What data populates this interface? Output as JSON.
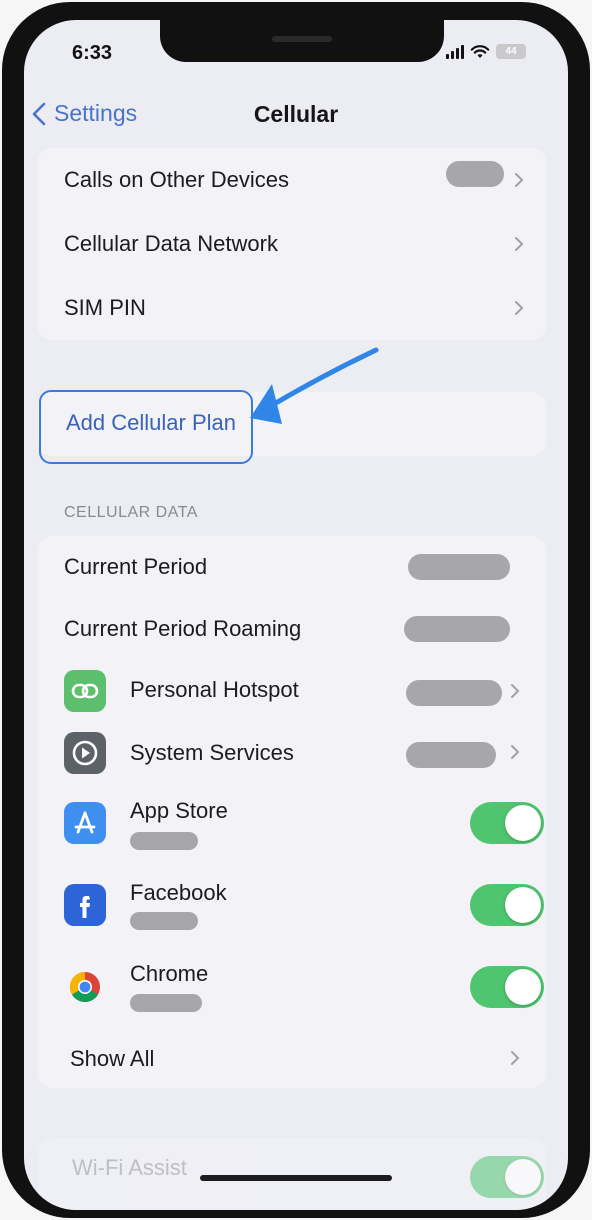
{
  "status_bar": {
    "time": "6:33",
    "battery": "44"
  },
  "nav": {
    "back_label": "Settings",
    "title": "Cellular"
  },
  "top_group": {
    "calls_on_other_devices": "Calls on Other Devices",
    "cellular_data_network": "Cellular Data Network",
    "sim_pin": "SIM PIN"
  },
  "add_plan": {
    "label": "Add Cellular Plan"
  },
  "cellular_data": {
    "header": "CELLULAR DATA",
    "current_period": "Current Period",
    "current_period_roaming": "Current Period Roaming",
    "personal_hotspot": "Personal Hotspot",
    "system_services": "System Services",
    "apps": [
      {
        "name": "App Store",
        "icon": "app-store-icon",
        "enabled": true
      },
      {
        "name": "Facebook",
        "icon": "facebook-icon",
        "enabled": true
      },
      {
        "name": "Chrome",
        "icon": "chrome-icon",
        "enabled": true
      }
    ],
    "show_all": "Show All"
  },
  "bottom_group": {
    "wifi_assist": "Wi-Fi Assist"
  },
  "colors": {
    "accent": "#3d7ad8",
    "toggle_on": "#4ec56e",
    "hotspot_green": "#5cbf6e",
    "system_gray": "#5d6168",
    "app_store_blue": "#3f8ff0",
    "facebook_blue": "#2d64d8"
  }
}
